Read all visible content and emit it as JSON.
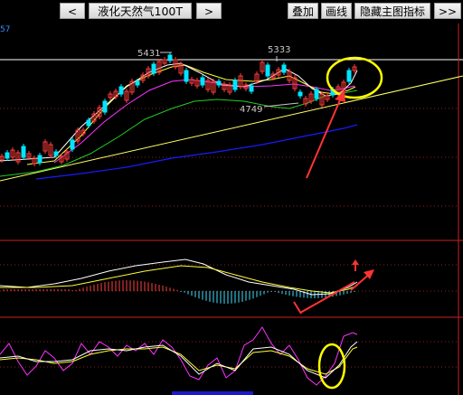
{
  "toolbar": {
    "prev_label": "<",
    "title": "液化天然气100T",
    "next_label": ">",
    "overlay_label": "叠加",
    "draw_label": "画线",
    "hide_main_indicator_label": "隐藏主图指标",
    "more_label": ">>"
  },
  "axis_fragment": "57",
  "chart_annotations": {
    "high_label": "5431",
    "peak_label": "5333",
    "low_label": "4749"
  },
  "colors": {
    "background": "#000000",
    "up_candle": "#ff3b3b",
    "down_candle": "#00e5ff",
    "ma_white": "#ffffff",
    "ma_yellow": "#ffff33",
    "ma_magenta": "#ff33ff",
    "ma_green": "#22cc22",
    "ma_blue": "#1a1aff",
    "annotation_circle": "#ffff00",
    "annotation_arrow": "#ff3333"
  },
  "icons": [
    "arrow-up-icon"
  ]
}
